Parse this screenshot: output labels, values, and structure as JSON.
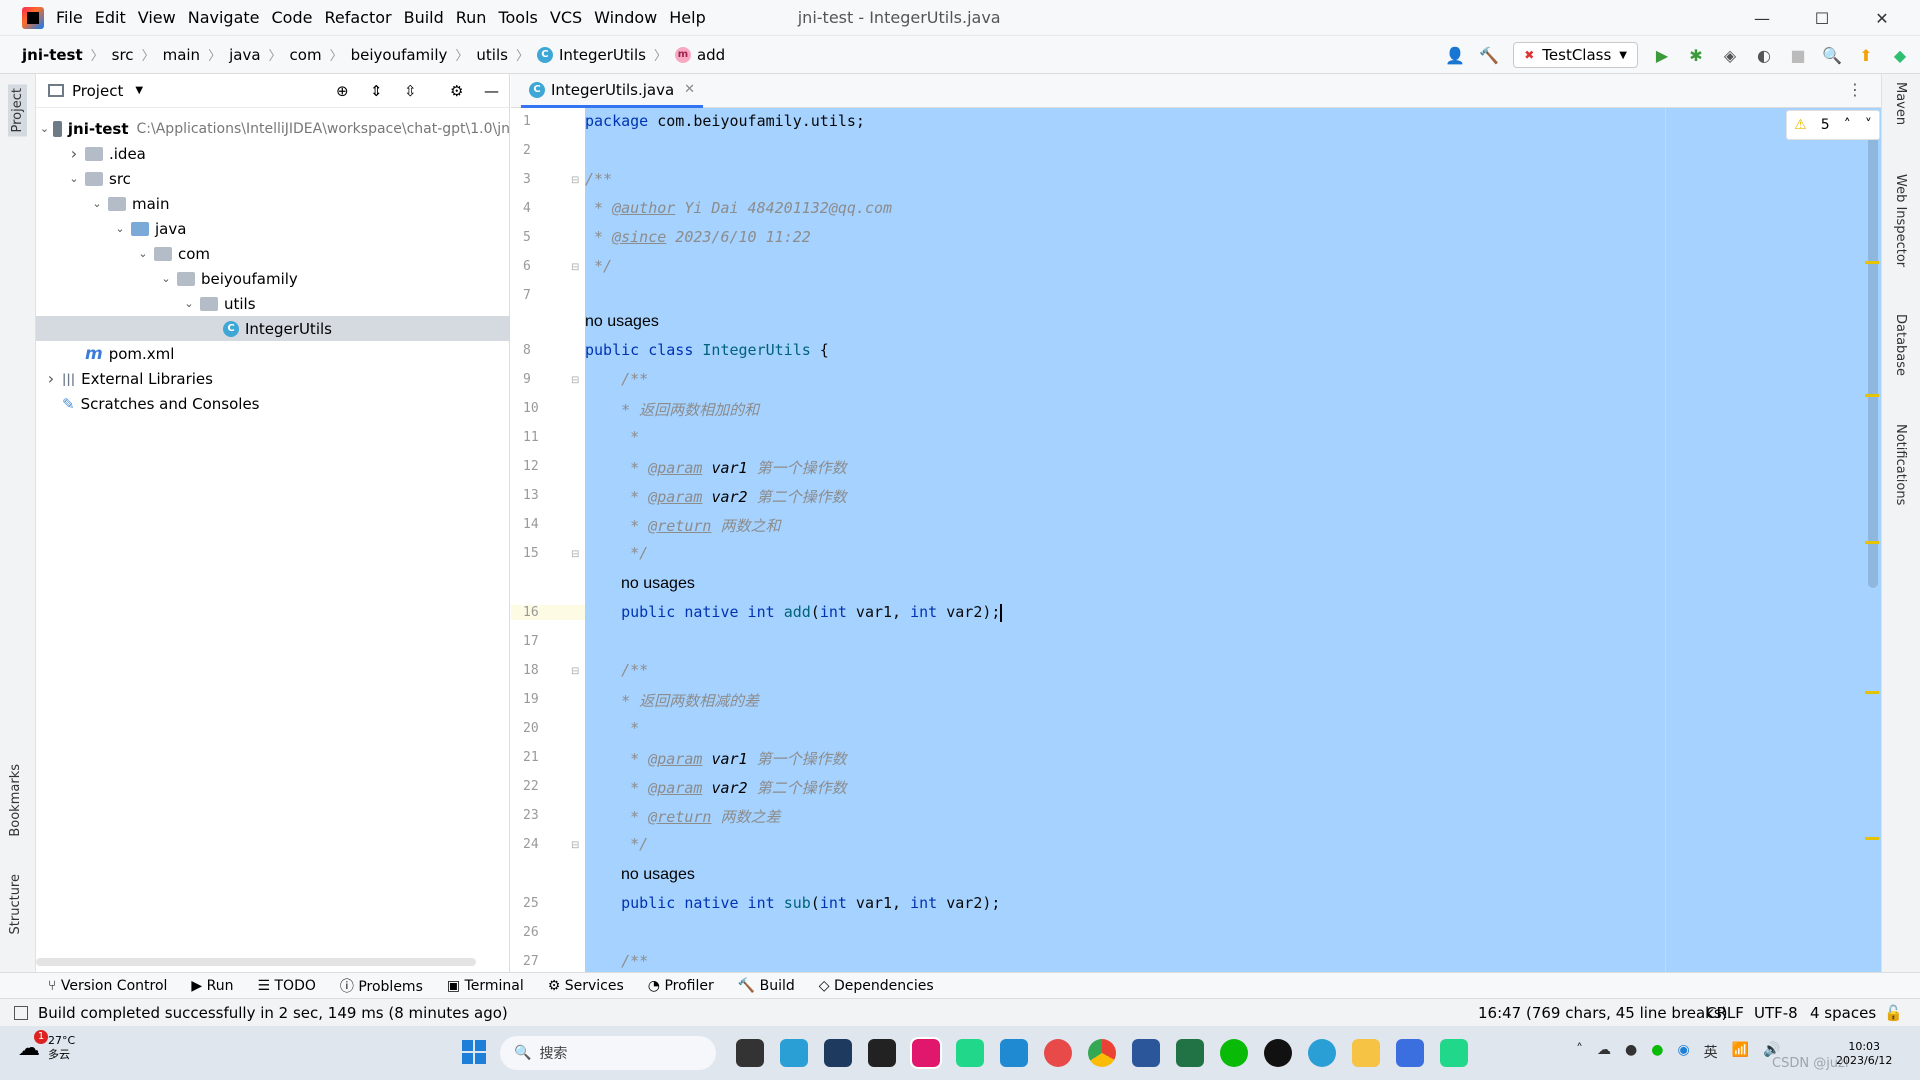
{
  "titlebar": {
    "menus": [
      "File",
      "Edit",
      "View",
      "Navigate",
      "Code",
      "Refactor",
      "Build",
      "Run",
      "Tools",
      "VCS",
      "Window",
      "Help"
    ],
    "title": "jni-test - IntegerUtils.java",
    "minimize": "—",
    "maximize": "☐",
    "close": "✕"
  },
  "breadcrumbs": [
    "jni-test",
    "src",
    "main",
    "java",
    "com",
    "beiyoufamily",
    "utils",
    "IntegerUtils",
    "add"
  ],
  "toolbar": {
    "run_config": "TestClass"
  },
  "project_panel": {
    "title": "Project",
    "tree": [
      {
        "label": "jni-test",
        "extra": "C:\\Applications\\IntelliJIDEA\\workspace\\chat-gpt\\1.0\\jn",
        "depth": 0,
        "expanded": true,
        "kind": "module",
        "bold": true
      },
      {
        "label": ".idea",
        "depth": 1,
        "expanded": false,
        "kind": "folder"
      },
      {
        "label": "src",
        "depth": 1,
        "expanded": true,
        "kind": "folder"
      },
      {
        "label": "main",
        "depth": 2,
        "expanded": true,
        "kind": "folder"
      },
      {
        "label": "java",
        "depth": 3,
        "expanded": true,
        "kind": "folder-blue"
      },
      {
        "label": "com",
        "depth": 4,
        "expanded": true,
        "kind": "package"
      },
      {
        "label": "beiyoufamily",
        "depth": 5,
        "expanded": true,
        "kind": "package"
      },
      {
        "label": "utils",
        "depth": 6,
        "expanded": true,
        "kind": "package"
      },
      {
        "label": "IntegerUtils",
        "depth": 7,
        "kind": "class",
        "selected": true
      },
      {
        "label": "pom.xml",
        "depth": 1,
        "kind": "maven"
      },
      {
        "label": "External Libraries",
        "depth": 0,
        "expanded": false,
        "kind": "libs"
      },
      {
        "label": "Scratches and Consoles",
        "depth": 0,
        "kind": "scratch"
      }
    ]
  },
  "editor": {
    "tab": "IntegerUtils.java",
    "warnings": "5",
    "hint": "no usages",
    "code_lines": {
      "l1": "com.beiyoufamily.utils;",
      "l3": "/**",
      "l4_tag": "@author",
      "l4_text": " Yi Dai 484201132@qq.com",
      "l5_tag": "@since",
      "l5_text": " 2023/6/10 11:22",
      "l6": " */",
      "l8_class": "IntegerUtils",
      "l10": " * 返回两数相加的和",
      "l12_text": " 第一个操作数",
      "l13_text": " 第二个操作数",
      "l14_text": " 两数之和",
      "l16_fn": "add",
      "l19": " * 返回两数相减的差",
      "l23_text": " 两数之差",
      "l25_fn": "sub"
    },
    "line_numbers": [
      "1",
      "2",
      "3",
      "4",
      "5",
      "6",
      "7",
      "8",
      "9",
      "10",
      "11",
      "12",
      "13",
      "14",
      "15",
      "16",
      "17",
      "18",
      "19",
      "20",
      "21",
      "22",
      "23",
      "24",
      "25",
      "26",
      "27"
    ]
  },
  "right_tabs": [
    "Maven",
    "Web Inspector",
    "Database",
    "Notifications"
  ],
  "left_tabs": [
    "Project",
    "Bookmarks",
    "Structure"
  ],
  "bottom_tools": [
    "Version Control",
    "Run",
    "TODO",
    "Problems",
    "Terminal",
    "Services",
    "Profiler",
    "Build",
    "Dependencies"
  ],
  "status": {
    "message": "Build completed successfully in 2 sec, 149 ms (8 minutes ago)",
    "position": "16:47 (769 chars, 45 line breaks)",
    "line_sep": "CRLF",
    "encoding": "UTF-8",
    "indent": "4 spaces"
  },
  "taskbar": {
    "weather_temp": "27°C",
    "weather_desc": "多云",
    "search": "搜索",
    "lang": "英",
    "time": "10:03",
    "date": "2023/6/12",
    "watermark": "CSDN @juzi"
  }
}
